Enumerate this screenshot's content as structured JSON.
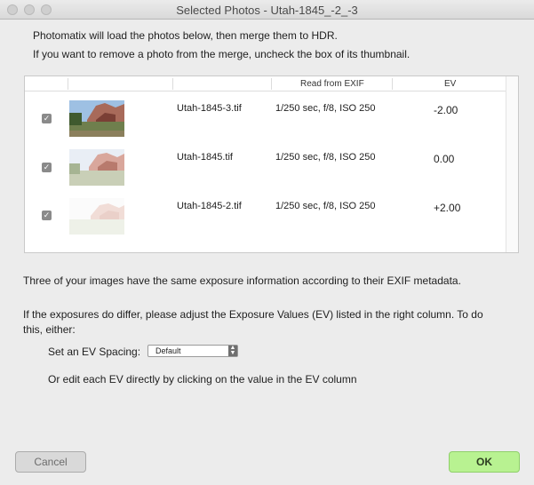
{
  "window": {
    "title": "Selected Photos - Utah-1845_-2_-3"
  },
  "intro": {
    "line1": "Photomatix will load the photos below, then merge them to HDR.",
    "line2": "If you want to remove a photo from the merge, uncheck the box of its thumbnail."
  },
  "table": {
    "headers": {
      "exif": "Read from EXIF",
      "ev": "EV"
    },
    "rows": [
      {
        "checked": true,
        "filename": "Utah-1845-3.tif",
        "exif": "1/250 sec, f/8, ISO 250",
        "ev": "-2.00"
      },
      {
        "checked": true,
        "filename": "Utah-1845.tif",
        "exif": "1/250 sec, f/8, ISO 250",
        "ev": "0.00"
      },
      {
        "checked": true,
        "filename": "Utah-1845-2.tif",
        "exif": "1/250 sec, f/8, ISO 250",
        "ev": "+2.00"
      }
    ]
  },
  "messages": {
    "same_exposure": "Three of your images have the same exposure information according to their EXIF metadata.",
    "adjust": "If the exposures do differ, please adjust the Exposure Values (EV) listed in the right column. To do this, either:",
    "ev_spacing_label": "Set an EV Spacing:",
    "edit_note": "Or edit each EV directly by clicking on the value in the EV column"
  },
  "ev_spacing": {
    "selected": "Default"
  },
  "buttons": {
    "cancel": "Cancel",
    "ok": "OK"
  },
  "colors": {
    "ok_button": "#b8f291",
    "checkbox": "#8a8a8a"
  },
  "icons": {
    "checkbox": "checkmark-icon",
    "select": "updown-arrows-icon"
  }
}
